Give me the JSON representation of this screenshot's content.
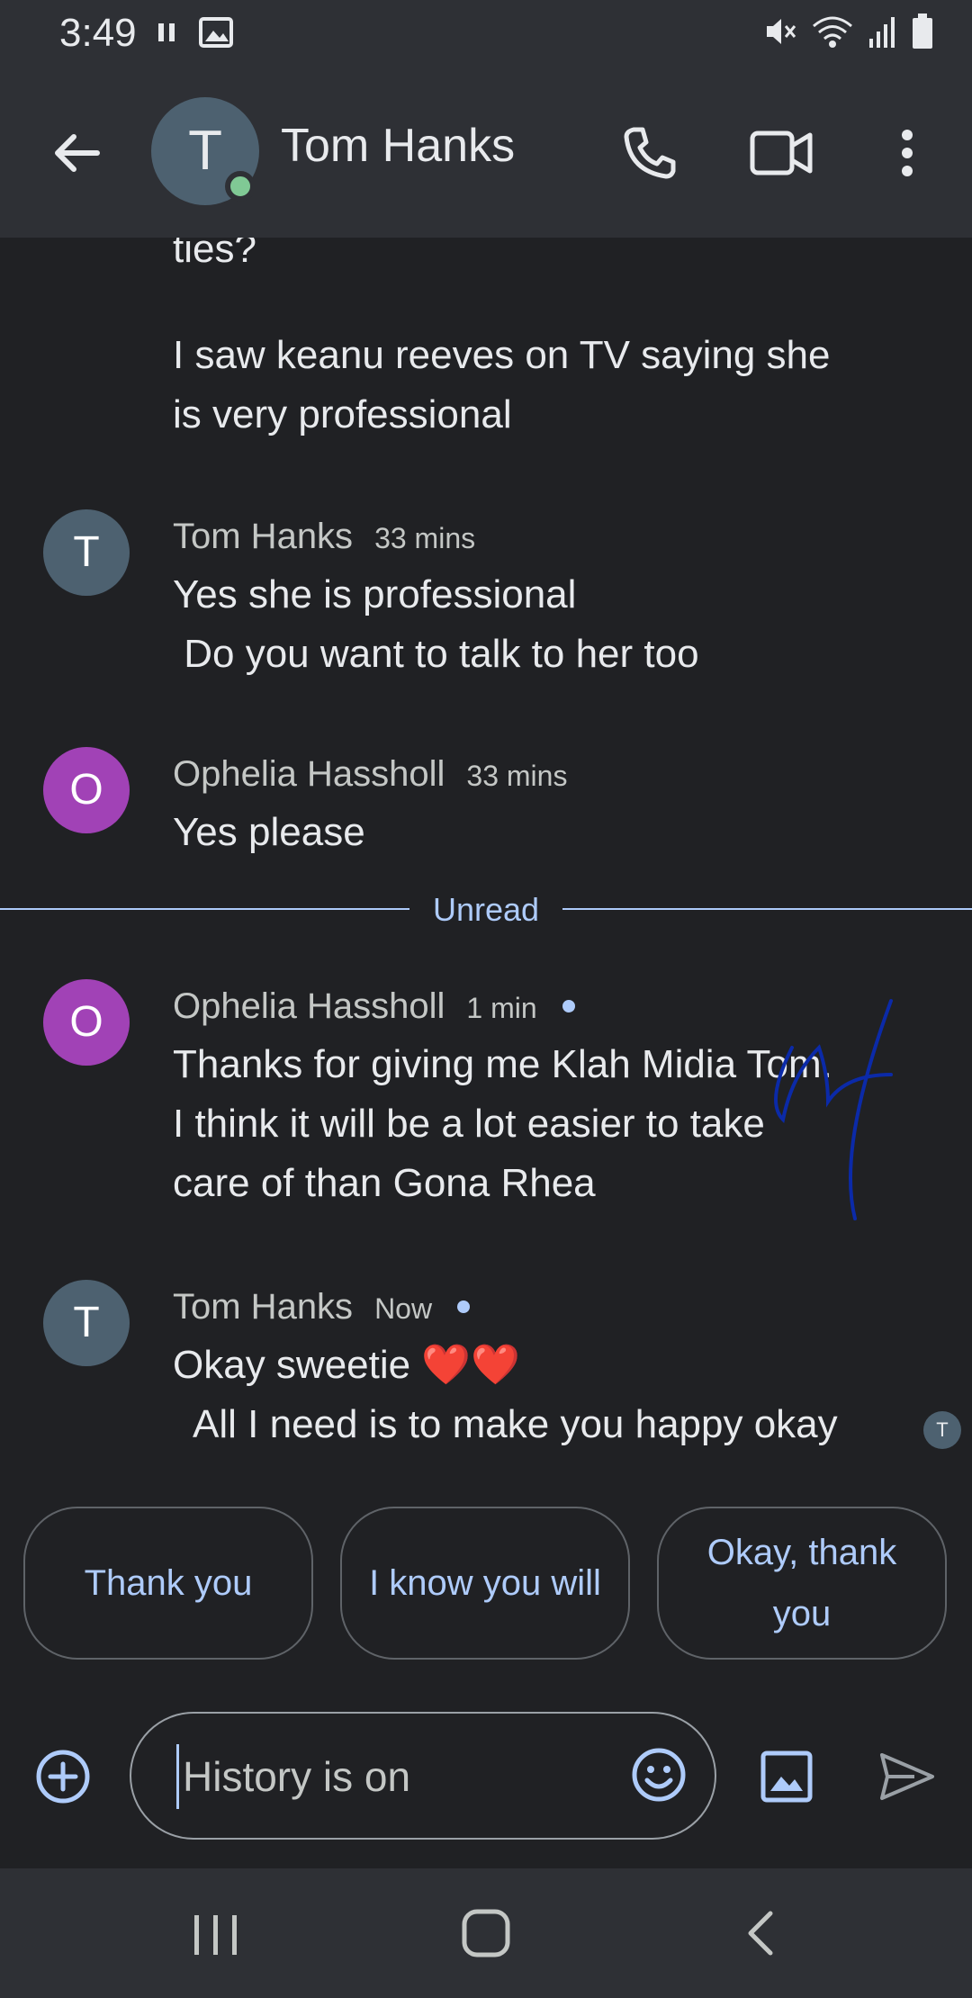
{
  "status_bar": {
    "time": "3:49"
  },
  "header": {
    "contact_name": "Tom Hanks",
    "avatar_initial": "T",
    "presence_color": "#80c995"
  },
  "messages": {
    "continued_text_1": "ties?",
    "continued_text_2": "I saw keanu reeves on TV saying she\nis very professional",
    "group_1": {
      "avatar_initial": "T",
      "avatar_color": "#4d6170",
      "sender": "Tom Hanks",
      "time": "33 mins",
      "text": "Yes she is professional\n Do you want to talk to her too"
    },
    "group_2": {
      "avatar_initial": "O",
      "avatar_color": "#a142b6",
      "sender": "Ophelia Hassholl",
      "time": "33 mins",
      "text": "Yes please"
    },
    "unread_label": "Unread",
    "group_3": {
      "avatar_initial": "O",
      "avatar_color": "#a142b6",
      "sender": "Ophelia Hassholl",
      "time": "1 min",
      "text": "Thanks for giving me Klah Midia Tom.\nI think it will be a lot easier to take\ncare of than Gona Rhea"
    },
    "group_4": {
      "avatar_initial": "T",
      "avatar_color": "#4d6170",
      "sender": "Tom Hanks",
      "time": "Now",
      "text": "Okay sweetie ❤️❤️\n  All I need is to make you happy okay"
    },
    "read_receipt_initial": "T"
  },
  "smart_replies": [
    {
      "label": "Thank you"
    },
    {
      "label": "I know you will"
    },
    {
      "label": "Okay, thank you"
    }
  ],
  "composer": {
    "placeholder": "History is on"
  },
  "icons": {
    "back": "arrow-back-icon",
    "call": "phone-icon",
    "video": "video-camera-icon",
    "more": "more-vert-icon",
    "add": "add-circle-icon",
    "emoji": "emoji-icon",
    "gallery": "image-icon",
    "send": "send-icon"
  },
  "colors": {
    "accent": "#aecbfa",
    "background": "#202124",
    "bar": "#2e3035"
  }
}
